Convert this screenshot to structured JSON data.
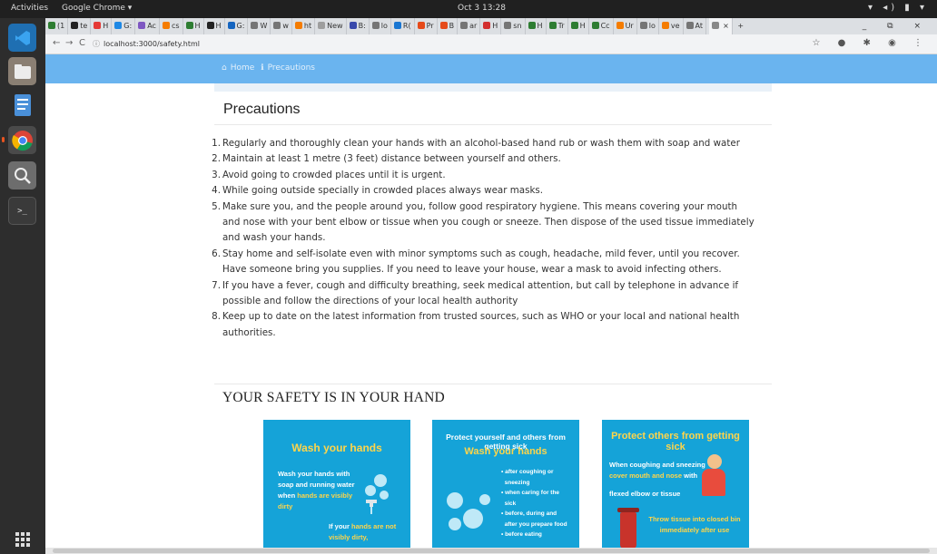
{
  "topbar": {
    "activities": "Activities",
    "app_menu": "Google Chrome ▾",
    "clock": "Oct 3  13:28",
    "sys_icons": "▾ ◂) ▮ ▾"
  },
  "dock": {
    "apps": [
      "vscode-icon",
      "files-icon",
      "text-editor-icon",
      "chrome-icon",
      "image-viewer-icon",
      "terminal-icon"
    ]
  },
  "tabs": [
    {
      "label": "(1",
      "color": "#2e7d32"
    },
    {
      "label": "te",
      "color": "#222222"
    },
    {
      "label": "H",
      "color": "#e53935"
    },
    {
      "label": "G:",
      "color": "#1e88e5"
    },
    {
      "label": "Ac",
      "color": "#7e57c2"
    },
    {
      "label": "cs",
      "color": "#f57c00"
    },
    {
      "label": "H",
      "color": "#2e7d32"
    },
    {
      "label": "H",
      "color": "#222222"
    },
    {
      "label": "G:",
      "color": "#1565c0"
    },
    {
      "label": "W",
      "color": "#757575"
    },
    {
      "label": "w",
      "color": "#757575"
    },
    {
      "label": "ht",
      "color": "#f57c00"
    },
    {
      "label": "New",
      "color": "#9e9e9e"
    },
    {
      "label": "B:",
      "color": "#3949ab"
    },
    {
      "label": "lo",
      "color": "#757575"
    },
    {
      "label": "R(",
      "color": "#1976d2"
    },
    {
      "label": "Pr",
      "color": "#e64a19"
    },
    {
      "label": "B",
      "color": "#e64a19"
    },
    {
      "label": "ar",
      "color": "#757575"
    },
    {
      "label": "H",
      "color": "#d32f2f"
    },
    {
      "label": "sn",
      "color": "#757575"
    },
    {
      "label": "H",
      "color": "#2e7d32"
    },
    {
      "label": "Tr",
      "color": "#2e7d32"
    },
    {
      "label": "H",
      "color": "#2e7d32"
    },
    {
      "label": "Cc",
      "color": "#2e7d32"
    },
    {
      "label": "Ur",
      "color": "#f57c00"
    },
    {
      "label": "lo",
      "color": "#757575"
    },
    {
      "label": "ve",
      "color": "#f57c00"
    },
    {
      "label": "At",
      "color": "#757575"
    }
  ],
  "active_tab": {
    "label": "",
    "close": "×"
  },
  "new_tab": "+",
  "window_controls": "_ ⧉ ×",
  "toolbar": {
    "back": "←",
    "forward": "→",
    "reload": "C",
    "url": "localhost:3000/safety.html",
    "extensions": "☆ ● ✱ ◉ ⋮"
  },
  "site": {
    "breadcrumb_home": "Home",
    "breadcrumb_current": "Precautions",
    "precautions_title": "Precautions",
    "precautions": [
      {
        "num": "1.",
        "text": "Regularly and thoroughly clean your hands with an alcohol-based hand rub or wash them with soap and water"
      },
      {
        "num": "2.",
        "text": "Maintain at least 1 metre (3 feet) distance between yourself and others."
      },
      {
        "num": "3.",
        "text": "Avoid going to crowded places until it is urgent."
      },
      {
        "num": "4.",
        "text": "While going outside specially in crowded places always wear masks."
      },
      {
        "num": "5.",
        "text": "Make sure you, and the people around you, follow good respiratory hygiene. This means covering your mouth and nose with your bent elbow or tissue when you cough or sneeze. Then dispose of the used tissue immediately and wash your hands."
      },
      {
        "num": "6.",
        "text": "Stay home and self-isolate even with minor symptoms such as cough, headache, mild fever, until you recover. Have someone bring you supplies. If you need to leave your house, wear a mask to avoid infecting others."
      },
      {
        "num": "7.",
        "text": "If you have a fever, cough and difficulty breathing, seek medical attention, but call by telephone in advance if possible and follow the directions of your local health authority"
      },
      {
        "num": "8.",
        "text": "Keep up to date on the latest information from trusted sources, such as WHO or your local and national health authorities."
      }
    ],
    "safety_title": "YOUR SAFETY IS IN YOUR HAND",
    "card1": {
      "heading": "Wash your hands",
      "text1": "Wash your hands with soap and running water when",
      "text1_highlight": "hands are visibly dirty",
      "text2": "If your",
      "text2_highlight": "hands are not visibly dirty,"
    },
    "card2": {
      "subhead": "Protect yourself and others from getting sick",
      "heading": "Wash your hands",
      "bullets": [
        "• after coughing or",
        "  sneezing",
        "• when caring for the",
        "  sick",
        "• before, during and",
        "  after you prepare food",
        "• before eating"
      ]
    },
    "card3": {
      "heading": "Protect others from getting sick",
      "text1": "When coughing and sneezing",
      "text1_highlight": "cover mouth and nose",
      "text1_end": "with",
      "text2": "flexed elbow or tissue",
      "text3_highlight": "Throw tissue into closed bin immediately after use"
    }
  }
}
